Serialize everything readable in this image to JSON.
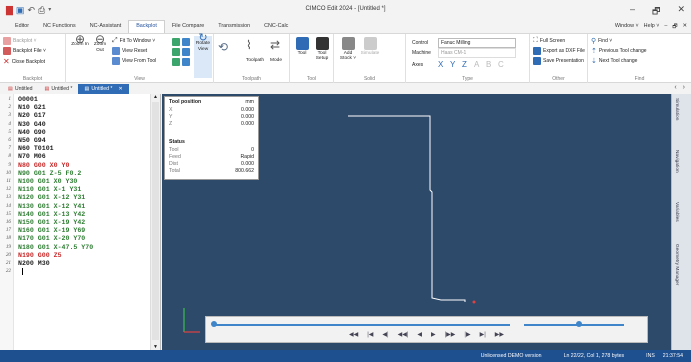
{
  "window": {
    "title": "CIMCO Edit 2024 - [Untitled *]",
    "minimize": "–",
    "maximize": "🗗",
    "close": "✕"
  },
  "quick_access": [
    "new-icon",
    "save-icon",
    "undo-icon",
    "print-icon",
    "dropdown-icon"
  ],
  "menu": {
    "items": [
      "Editor",
      "NC Functions",
      "NC-Assistant",
      "Backplot",
      "File Compare",
      "Transmission",
      "CNC-Calc"
    ],
    "active": "Backplot",
    "right": [
      "Window ˅",
      "Help ˅",
      "–",
      "🗗",
      "✕"
    ]
  },
  "ribbon": {
    "backplot": {
      "items": [
        "Backplot ˅",
        "Backplot File ˅",
        "Close Backplot"
      ],
      "zoom_in": "Zoom In",
      "zoom_out": "Zoom Out",
      "label": "Backplot"
    },
    "view": {
      "fit": "Fit To Window ˅",
      "reset": "View Reset",
      "from_tool": "View From Tool",
      "rotate": "Rotate View",
      "label": "View"
    },
    "toolpath": {
      "toolpath": "Toolpath",
      "mode": "Mode",
      "label": "Toolpath"
    },
    "tool": {
      "tool": "Tool",
      "setup": "Tool Setup",
      "label": "Tool"
    },
    "solid": {
      "add_stock": "Add Stock ˅",
      "simulate": "Simulate",
      "label": "Solid"
    },
    "type": {
      "control_label": "Control",
      "control_value": "Fanuc Milling",
      "machine_label": "Machine",
      "machine_value": "Haas CM-1",
      "axes_label": "Axes",
      "axes": [
        "X",
        "Y",
        "Z",
        "A",
        "B",
        "C"
      ],
      "label": "Type"
    },
    "other": {
      "full_screen": "Full Screen",
      "export_dxf": "Export as DXF File",
      "save_presentation": "Save Presentation",
      "label": "Other"
    },
    "find": {
      "find": "Find ˅",
      "prev_tool": "Previous Tool change",
      "next_tool": "Next Tool change",
      "label": "Find"
    }
  },
  "tabs": [
    {
      "label": "Untitled",
      "active": false
    },
    {
      "label": "Untitled *",
      "active": false
    },
    {
      "label": "Untitled *",
      "active": true
    }
  ],
  "tab_close": "✕",
  "tab_nav": [
    "‹",
    "›"
  ],
  "editor": {
    "lines": [
      {
        "n": "1",
        "code": "O0001",
        "color": "#222"
      },
      {
        "n": "2",
        "code": "N10 G21",
        "color": "#222"
      },
      {
        "n": "3",
        "code": "N20 G17",
        "color": "#222"
      },
      {
        "n": "4",
        "code": "N30 G40",
        "color": "#222"
      },
      {
        "n": "5",
        "code": "N40 G90",
        "color": "#222"
      },
      {
        "n": "6",
        "code": "N50 G94",
        "color": "#222"
      },
      {
        "n": "7",
        "code": "N60 T0101",
        "color": "#222"
      },
      {
        "n": "8",
        "code": "N70 M06",
        "color": "#222"
      },
      {
        "n": "9",
        "code": "N80 G00 X0 Y0",
        "color": "#c62828"
      },
      {
        "n": "10",
        "code": "N90 G01 Z-5 F0.2",
        "color": "#2e7d32"
      },
      {
        "n": "11",
        "code": "N100 G01 X0 Y30",
        "color": "#2e7d32"
      },
      {
        "n": "12",
        "code": "N110 G01 X-1 Y31",
        "color": "#2e7d32"
      },
      {
        "n": "13",
        "code": "N120 G01 X-12 Y31",
        "color": "#2e7d32"
      },
      {
        "n": "14",
        "code": "N130 G01 X-12 Y41",
        "color": "#2e7d32"
      },
      {
        "n": "15",
        "code": "N140 G01 X-13 Y42",
        "color": "#2e7d32"
      },
      {
        "n": "16",
        "code": "N150 G01 X-19 Y42",
        "color": "#2e7d32"
      },
      {
        "n": "17",
        "code": "N160 G01 X-19 Y69",
        "color": "#2e7d32"
      },
      {
        "n": "18",
        "code": "N170 G01 X-20 Y70",
        "color": "#2e7d32"
      },
      {
        "n": "19",
        "code": "N180 G01 X-47.5 Y70",
        "color": "#2e7d32"
      },
      {
        "n": "20",
        "code": "N190 G00 Z5",
        "color": "#c62828"
      },
      {
        "n": "21",
        "code": "N200 M30",
        "color": "#222"
      },
      {
        "n": "22",
        "code": "",
        "color": "#222"
      }
    ]
  },
  "tool_position": {
    "title": "Tool position",
    "unit": "mm",
    "coords": [
      {
        "axis": "X",
        "value": "0.000"
      },
      {
        "axis": "Y",
        "value": "0.000"
      },
      {
        "axis": "Z",
        "value": "0.000"
      }
    ],
    "status_title": "Status",
    "status": [
      {
        "label": "Tool",
        "value": "0"
      },
      {
        "label": "Feed",
        "value": "Rapid"
      },
      {
        "label": "Dist",
        "value": "0.000"
      },
      {
        "label": "Total",
        "value": "800.662"
      }
    ]
  },
  "side_tabs": [
    "Simulation",
    "Navigation",
    "Variables",
    "Geometry Manager"
  ],
  "player": {
    "progress": 0.0,
    "speed": 0.55,
    "buttons": [
      "◀◀",
      "|◀",
      "◀|",
      "◀◀|",
      "◀",
      "▶",
      "|▶▶",
      "|▶",
      "▶|",
      "▶▶"
    ]
  },
  "status": {
    "demo": "Unlicensed DEMO version",
    "position": "Ln 22/22, Col 1, 278 bytes",
    "mode": "INS",
    "time": "21:37:54"
  },
  "colors": {
    "viewport": "#2d4a6b",
    "toolpath": "#ffffff",
    "accent": "#2f6cb5",
    "statusbar": "#1e4f8f"
  }
}
